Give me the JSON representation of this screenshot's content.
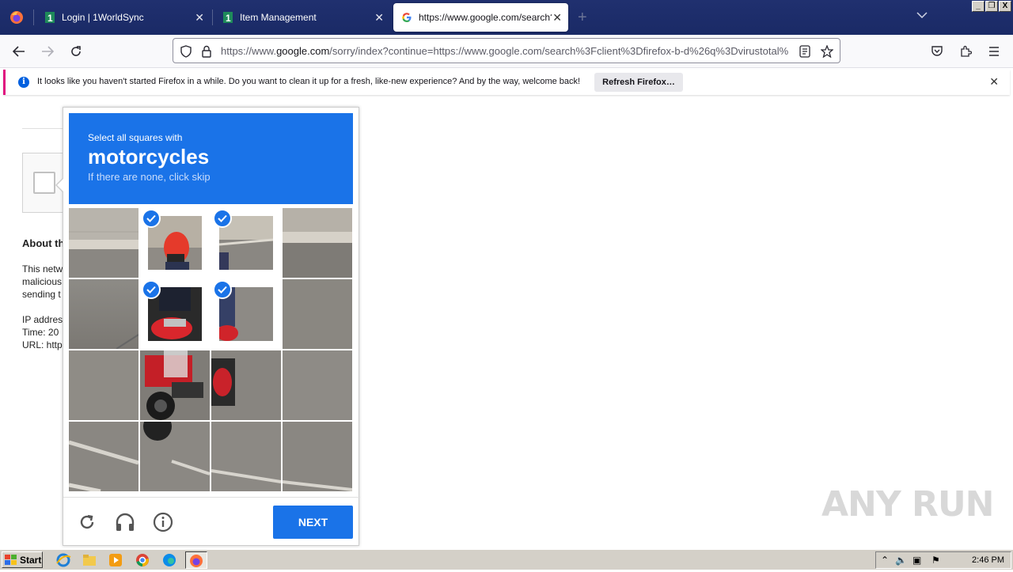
{
  "browser": {
    "tabs": [
      {
        "label": "Login | 1WorldSync",
        "active": false
      },
      {
        "label": "Item Management",
        "active": false
      },
      {
        "label": "https://www.google.com/search?c",
        "active": true
      }
    ],
    "url_prefix": "https://www.",
    "url_domain": "google.com",
    "url_rest": "/sorry/index?continue=https://www.google.com/search%3Fclient%3Dfirefox-b-d%26q%3Dvirustotal%",
    "window_controls": [
      "_",
      "❐",
      "X"
    ]
  },
  "notification": {
    "text": "It looks like you haven't started Firefox in a while. Do you want to clean it up for a fresh, like-new experience? And by the way, welcome back!",
    "button": "Refresh Firefox…"
  },
  "page": {
    "about_title": "About th",
    "lines": [
      "This netw",
      "malicious",
      "sending t",
      "IP addres",
      "Time: 20",
      "URL: http"
    ]
  },
  "captcha": {
    "instruction": "Select all squares with",
    "target": "motorcycles",
    "hint": "If there are none, click skip",
    "next_label": "NEXT",
    "selected_tiles": [
      1,
      2,
      5,
      6
    ]
  },
  "watermark": "ANY RUN",
  "taskbar": {
    "start": "Start",
    "time": "2:46 PM"
  }
}
